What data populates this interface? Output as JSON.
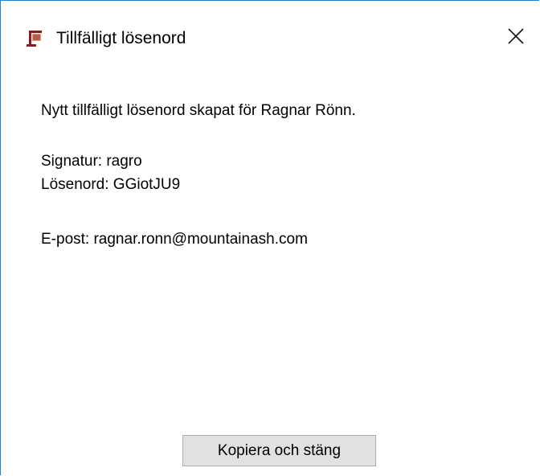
{
  "window": {
    "title": "Tillfälligt lösenord",
    "icon": "app-icon",
    "close_icon": "close-icon",
    "accent_color": "#1883d7"
  },
  "message": {
    "created_line": "Nytt tillfälligt lösenord skapat för Ragnar Rönn.",
    "signature_line": "Signatur: ragro",
    "password_line": "Lösenord: GGiotJU9",
    "email_line": "E-post: ragnar.ronn@mountainash.com"
  },
  "actions": {
    "copy_close_label": "Kopiera och stäng"
  }
}
